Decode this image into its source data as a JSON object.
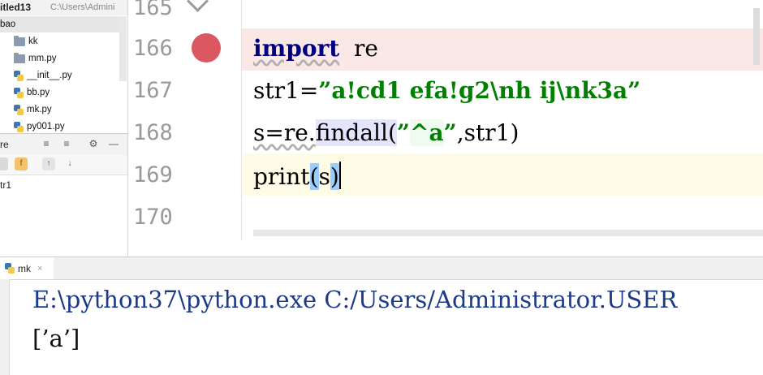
{
  "project": {
    "title": "itled13",
    "path": "C:\\Users\\Admini",
    "tree": [
      {
        "label": "bao",
        "type": "folder"
      },
      {
        "label": "kk",
        "type": "folder"
      },
      {
        "label": "mm.py",
        "type": "folder"
      },
      {
        "label": "__init__.py",
        "type": "py"
      },
      {
        "label": "bb.py",
        "type": "py"
      },
      {
        "label": "mk.py",
        "type": "py"
      },
      {
        "label": "py001.py",
        "type": "py"
      }
    ]
  },
  "structure": {
    "title": "re",
    "item": "tr1"
  },
  "editor": {
    "line_numbers": [
      "165",
      "166",
      "167",
      "168",
      "169",
      "170"
    ],
    "code": {
      "l166_kw": "import",
      "l166_rest": "  re",
      "l167": "str1=",
      "l167_str": "”a!cd1 efa!g2\\nh ij\\nk3a”",
      "l168_a": "s=re.",
      "l168_call": "findall",
      "l168_open": "(",
      "l168_q1": "”",
      "l168_caret": "^",
      "l168_a2": "a",
      "l168_q2": "”",
      "l168_rest": ",str1)",
      "l169_fn": "print",
      "l169_open": "(",
      "l169_arg": "s",
      "l169_close": ")"
    }
  },
  "run": {
    "tab_label": "mk",
    "tab_close": "×",
    "output": [
      "E:\\python37\\python.exe C:/Users/Administrator.USER",
      "[’a’]"
    ]
  },
  "colors": {
    "breakpoint_line": "#fae8e6",
    "caret_line": "#fefbe6",
    "breakpoint": "#db5860"
  }
}
